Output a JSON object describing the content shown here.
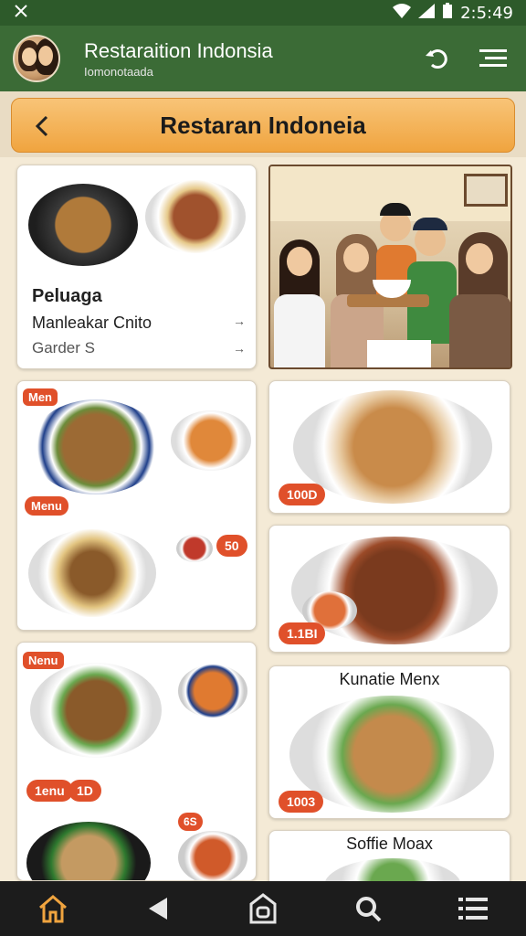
{
  "status_bar": {
    "time": "2:5:49",
    "left_icon": "app-logo-icon"
  },
  "app_bar": {
    "title": "Restaraition Indonsia",
    "subtitle": "Iomonotaada",
    "actions": [
      "sync-icon",
      "menu-icon"
    ]
  },
  "header": {
    "title": "Restaran Indoneia",
    "back_icon": "chevron-left-icon"
  },
  "feature_card": {
    "title": "Peluaga",
    "line1": "Manleakar Cnito",
    "line2": "Garder S",
    "arrow1": "→",
    "arrow2": "→"
  },
  "left_cards": [
    {
      "badge_top": "Men",
      "badge_mid": "Menu",
      "price": "50"
    },
    {
      "badge_top": "Nenu",
      "badge_b1": "1enu",
      "badge_b2": "1D",
      "badge_b3": "6S"
    }
  ],
  "right_cards": [
    {
      "price": "100D"
    },
    {
      "price": "1.1BI"
    },
    {
      "title": "Kunatie Menx",
      "price": "1003"
    },
    {
      "title": "Soffie Moax"
    }
  ],
  "colors": {
    "primary": "#3b6b36",
    "status": "#2d5a2a",
    "accent": "#f0a43f",
    "badge": "#e0502a",
    "nav": "#1c1c1c"
  },
  "nav": [
    "home-icon",
    "back-icon",
    "store-icon",
    "search-icon",
    "list-icon"
  ]
}
